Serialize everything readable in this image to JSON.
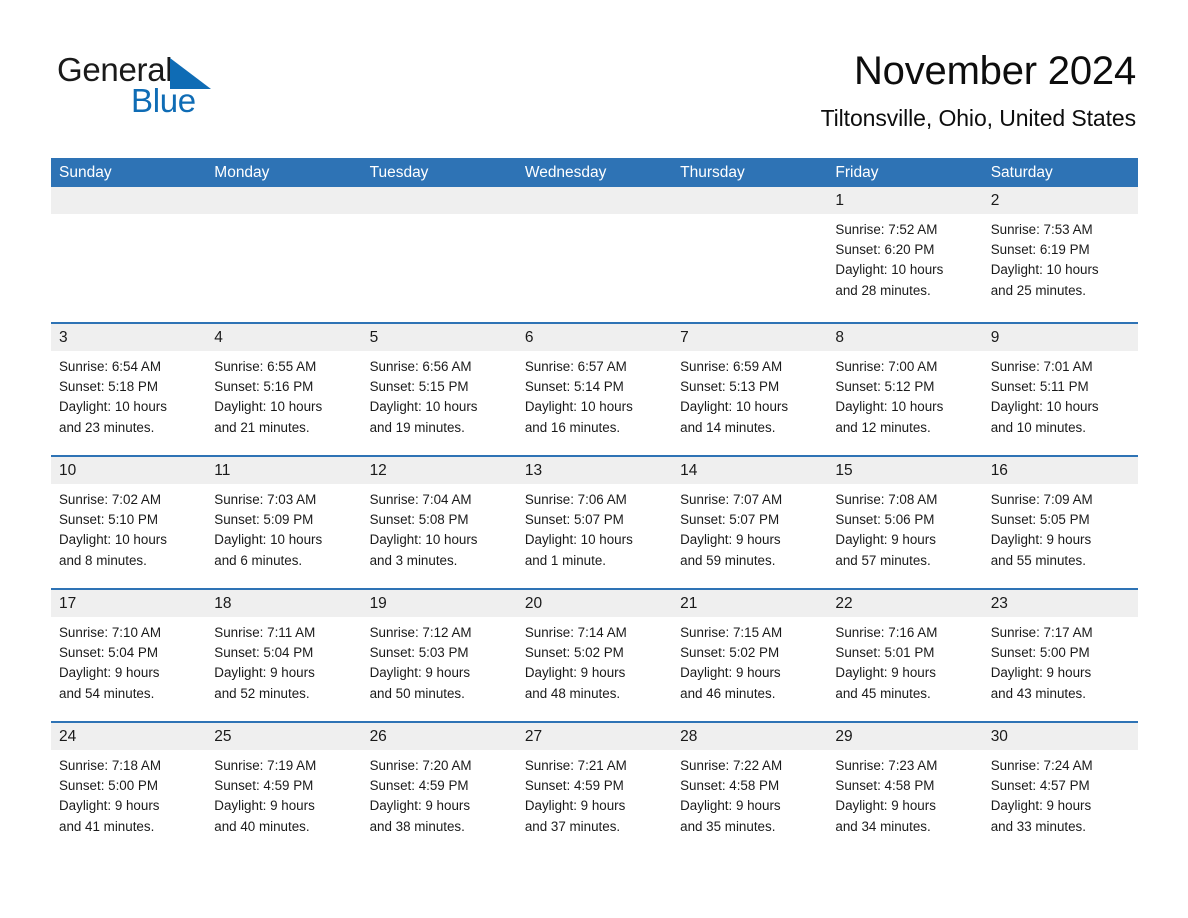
{
  "logo": {
    "text_primary": "General",
    "text_secondary": "Blue",
    "triangle_color": "#0f6cb5"
  },
  "header": {
    "title": "November 2024",
    "subtitle": "Tiltonsville, Ohio, United States"
  },
  "theme": {
    "header_blue": "#2e73b5",
    "daynum_band": "#efefef",
    "text": "#1a1a1a",
    "page_bg": "#ffffff"
  },
  "weekdays": [
    "Sunday",
    "Monday",
    "Tuesday",
    "Wednesday",
    "Thursday",
    "Friday",
    "Saturday"
  ],
  "weeks": [
    [
      {
        "day": "",
        "sunrise": "",
        "sunset": "",
        "daylight": ""
      },
      {
        "day": "",
        "sunrise": "",
        "sunset": "",
        "daylight": ""
      },
      {
        "day": "",
        "sunrise": "",
        "sunset": "",
        "daylight": ""
      },
      {
        "day": "",
        "sunrise": "",
        "sunset": "",
        "daylight": ""
      },
      {
        "day": "",
        "sunrise": "",
        "sunset": "",
        "daylight": ""
      },
      {
        "day": "1",
        "sunrise": "Sunrise: 7:52 AM",
        "sunset": "Sunset: 6:20 PM",
        "daylight": "Daylight: 10 hours and 28 minutes."
      },
      {
        "day": "2",
        "sunrise": "Sunrise: 7:53 AM",
        "sunset": "Sunset: 6:19 PM",
        "daylight": "Daylight: 10 hours and 25 minutes."
      }
    ],
    [
      {
        "day": "3",
        "sunrise": "Sunrise: 6:54 AM",
        "sunset": "Sunset: 5:18 PM",
        "daylight": "Daylight: 10 hours and 23 minutes."
      },
      {
        "day": "4",
        "sunrise": "Sunrise: 6:55 AM",
        "sunset": "Sunset: 5:16 PM",
        "daylight": "Daylight: 10 hours and 21 minutes."
      },
      {
        "day": "5",
        "sunrise": "Sunrise: 6:56 AM",
        "sunset": "Sunset: 5:15 PM",
        "daylight": "Daylight: 10 hours and 19 minutes."
      },
      {
        "day": "6",
        "sunrise": "Sunrise: 6:57 AM",
        "sunset": "Sunset: 5:14 PM",
        "daylight": "Daylight: 10 hours and 16 minutes."
      },
      {
        "day": "7",
        "sunrise": "Sunrise: 6:59 AM",
        "sunset": "Sunset: 5:13 PM",
        "daylight": "Daylight: 10 hours and 14 minutes."
      },
      {
        "day": "8",
        "sunrise": "Sunrise: 7:00 AM",
        "sunset": "Sunset: 5:12 PM",
        "daylight": "Daylight: 10 hours and 12 minutes."
      },
      {
        "day": "9",
        "sunrise": "Sunrise: 7:01 AM",
        "sunset": "Sunset: 5:11 PM",
        "daylight": "Daylight: 10 hours and 10 minutes."
      }
    ],
    [
      {
        "day": "10",
        "sunrise": "Sunrise: 7:02 AM",
        "sunset": "Sunset: 5:10 PM",
        "daylight": "Daylight: 10 hours and 8 minutes."
      },
      {
        "day": "11",
        "sunrise": "Sunrise: 7:03 AM",
        "sunset": "Sunset: 5:09 PM",
        "daylight": "Daylight: 10 hours and 6 minutes."
      },
      {
        "day": "12",
        "sunrise": "Sunrise: 7:04 AM",
        "sunset": "Sunset: 5:08 PM",
        "daylight": "Daylight: 10 hours and 3 minutes."
      },
      {
        "day": "13",
        "sunrise": "Sunrise: 7:06 AM",
        "sunset": "Sunset: 5:07 PM",
        "daylight": "Daylight: 10 hours and 1 minute."
      },
      {
        "day": "14",
        "sunrise": "Sunrise: 7:07 AM",
        "sunset": "Sunset: 5:07 PM",
        "daylight": "Daylight: 9 hours and 59 minutes."
      },
      {
        "day": "15",
        "sunrise": "Sunrise: 7:08 AM",
        "sunset": "Sunset: 5:06 PM",
        "daylight": "Daylight: 9 hours and 57 minutes."
      },
      {
        "day": "16",
        "sunrise": "Sunrise: 7:09 AM",
        "sunset": "Sunset: 5:05 PM",
        "daylight": "Daylight: 9 hours and 55 minutes."
      }
    ],
    [
      {
        "day": "17",
        "sunrise": "Sunrise: 7:10 AM",
        "sunset": "Sunset: 5:04 PM",
        "daylight": "Daylight: 9 hours and 54 minutes."
      },
      {
        "day": "18",
        "sunrise": "Sunrise: 7:11 AM",
        "sunset": "Sunset: 5:04 PM",
        "daylight": "Daylight: 9 hours and 52 minutes."
      },
      {
        "day": "19",
        "sunrise": "Sunrise: 7:12 AM",
        "sunset": "Sunset: 5:03 PM",
        "daylight": "Daylight: 9 hours and 50 minutes."
      },
      {
        "day": "20",
        "sunrise": "Sunrise: 7:14 AM",
        "sunset": "Sunset: 5:02 PM",
        "daylight": "Daylight: 9 hours and 48 minutes."
      },
      {
        "day": "21",
        "sunrise": "Sunrise: 7:15 AM",
        "sunset": "Sunset: 5:02 PM",
        "daylight": "Daylight: 9 hours and 46 minutes."
      },
      {
        "day": "22",
        "sunrise": "Sunrise: 7:16 AM",
        "sunset": "Sunset: 5:01 PM",
        "daylight": "Daylight: 9 hours and 45 minutes."
      },
      {
        "day": "23",
        "sunrise": "Sunrise: 7:17 AM",
        "sunset": "Sunset: 5:00 PM",
        "daylight": "Daylight: 9 hours and 43 minutes."
      }
    ],
    [
      {
        "day": "24",
        "sunrise": "Sunrise: 7:18 AM",
        "sunset": "Sunset: 5:00 PM",
        "daylight": "Daylight: 9 hours and 41 minutes."
      },
      {
        "day": "25",
        "sunrise": "Sunrise: 7:19 AM",
        "sunset": "Sunset: 4:59 PM",
        "daylight": "Daylight: 9 hours and 40 minutes."
      },
      {
        "day": "26",
        "sunrise": "Sunrise: 7:20 AM",
        "sunset": "Sunset: 4:59 PM",
        "daylight": "Daylight: 9 hours and 38 minutes."
      },
      {
        "day": "27",
        "sunrise": "Sunrise: 7:21 AM",
        "sunset": "Sunset: 4:59 PM",
        "daylight": "Daylight: 9 hours and 37 minutes."
      },
      {
        "day": "28",
        "sunrise": "Sunrise: 7:22 AM",
        "sunset": "Sunset: 4:58 PM",
        "daylight": "Daylight: 9 hours and 35 minutes."
      },
      {
        "day": "29",
        "sunrise": "Sunrise: 7:23 AM",
        "sunset": "Sunset: 4:58 PM",
        "daylight": "Daylight: 9 hours and 34 minutes."
      },
      {
        "day": "30",
        "sunrise": "Sunrise: 7:24 AM",
        "sunset": "Sunset: 4:57 PM",
        "daylight": "Daylight: 9 hours and 33 minutes."
      }
    ]
  ]
}
